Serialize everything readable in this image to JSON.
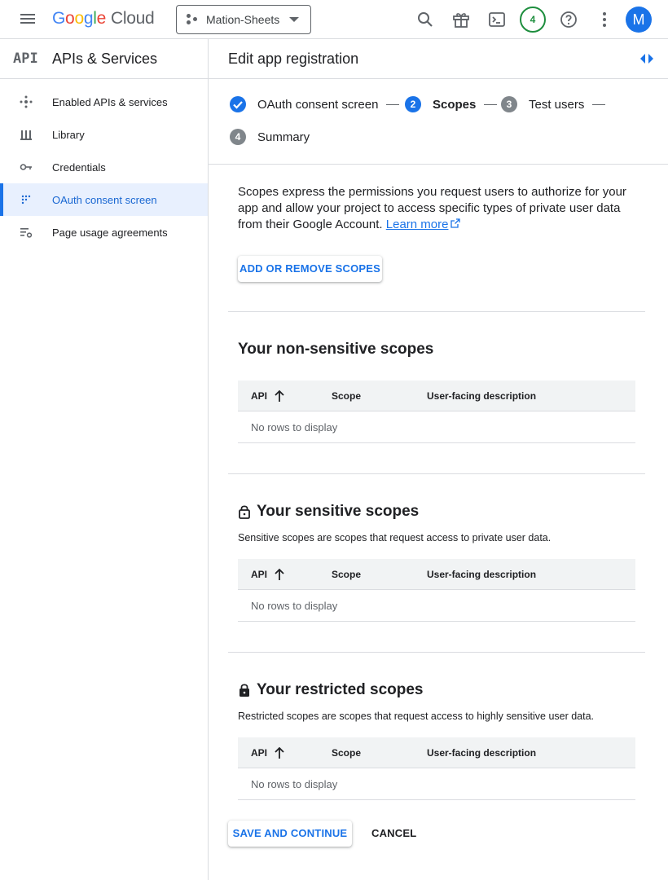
{
  "header": {
    "logo_letters": [
      "G",
      "o",
      "o",
      "g",
      "l",
      "e"
    ],
    "logo_suffix": "Cloud",
    "project_name": "Mation-Sheets",
    "notification_count": "4",
    "avatar_letter": "M"
  },
  "sidebar": {
    "logo": "API",
    "title": "APIs & Services",
    "items": [
      {
        "label": "Enabled APIs & services",
        "icon": "hub-icon"
      },
      {
        "label": "Library",
        "icon": "library-icon"
      },
      {
        "label": "Credentials",
        "icon": "key-icon"
      },
      {
        "label": "OAuth consent screen",
        "icon": "consent-icon",
        "active": true
      },
      {
        "label": "Page usage agreements",
        "icon": "settings-list-icon"
      }
    ]
  },
  "main": {
    "title": "Edit app registration",
    "steps": [
      {
        "number": "",
        "label": "OAuth consent screen",
        "state": "done"
      },
      {
        "number": "2",
        "label": "Scopes",
        "state": "current"
      },
      {
        "number": "3",
        "label": "Test users",
        "state": "todo"
      },
      {
        "number": "4",
        "label": "Summary",
        "state": "todo"
      }
    ],
    "intro_text": "Scopes express the permissions you request users to authorize for your app and allow your project to access specific types of private user data from their Google Account.",
    "learn_more": "Learn more",
    "add_scopes_button": "ADD OR REMOVE SCOPES",
    "sections": [
      {
        "title": "Your non-sensitive scopes",
        "description": "",
        "icon": "",
        "columns": [
          "API",
          "Scope",
          "User-facing description"
        ],
        "empty_text": "No rows to display"
      },
      {
        "title": "Your sensitive scopes",
        "description": "Sensitive scopes are scopes that request access to private user data.",
        "icon": "lock-open-icon",
        "columns": [
          "API",
          "Scope",
          "User-facing description"
        ],
        "empty_text": "No rows to display"
      },
      {
        "title": "Your restricted scopes",
        "description": "Restricted scopes are scopes that request access to highly sensitive user data.",
        "icon": "lock-icon",
        "columns": [
          "API",
          "Scope",
          "User-facing description"
        ],
        "empty_text": "No rows to display"
      }
    ],
    "save_button": "SAVE AND CONTINUE",
    "cancel_button": "CANCEL"
  },
  "colors": {
    "accent": "#1a73e8",
    "step_todo": "#80868b",
    "notification": "#1e8e3e"
  }
}
